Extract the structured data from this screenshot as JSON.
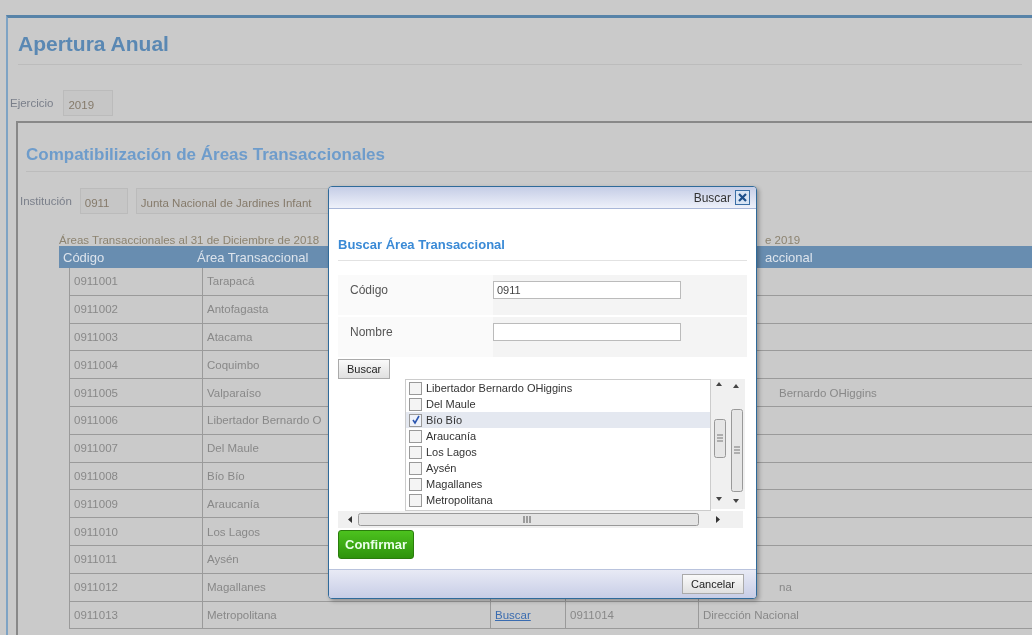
{
  "page": {
    "title": "Apertura Anual",
    "ejercicio": {
      "label": "Ejercicio",
      "value": "2019"
    }
  },
  "section": {
    "title": "Compatibilización de Áreas Transaccionales",
    "institucion": {
      "label": "Institución",
      "code": "0911",
      "name": "Junta Nacional de Jardines Infant"
    }
  },
  "table": {
    "caption_left": "Áreas Transaccionales al 31 de Diciembre de 2018",
    "caption_right": "e 2019",
    "columns": [
      "Código",
      "Área Transaccional",
      "accional"
    ],
    "rows": [
      {
        "code": "0911001",
        "area": "Tarapacá"
      },
      {
        "code": "0911002",
        "area": "Antofagasta"
      },
      {
        "code": "0911003",
        "area": "Atacama"
      },
      {
        "code": "0911004",
        "area": "Coquimbo"
      },
      {
        "code": "0911005",
        "area": "Valparaíso",
        "area2": "Bernardo OHiggins"
      },
      {
        "code": "0911006",
        "area": "Libertador Bernardo O"
      },
      {
        "code": "0911007",
        "area": "Del Maule"
      },
      {
        "code": "0911008",
        "area": "Bío Bío"
      },
      {
        "code": "0911009",
        "area": "Araucanía"
      },
      {
        "code": "0911010",
        "area": "Los Lagos"
      },
      {
        "code": "0911011",
        "area": "Aysén"
      },
      {
        "code": "0911012",
        "area": "Magallanes",
        "area2": "na"
      },
      {
        "code": "0911013",
        "area": "Metropolitana",
        "link": "Buscar",
        "code2": "0911014",
        "area2": "Dirección Nacional"
      }
    ]
  },
  "dialog": {
    "title": "Buscar",
    "heading": "Buscar Área Transaccional",
    "fields": [
      {
        "label": "Código",
        "value": "0911"
      },
      {
        "label": "Nombre"
      }
    ],
    "search_button": "Buscar",
    "items": [
      {
        "label": "Libertador Bernardo OHiggins",
        "checked": false,
        "selected": false
      },
      {
        "label": "Del Maule",
        "checked": false,
        "selected": false
      },
      {
        "label": "Bío Bío",
        "checked": true,
        "selected": true
      },
      {
        "label": "Araucanía",
        "checked": false,
        "selected": false
      },
      {
        "label": "Los Lagos",
        "checked": false,
        "selected": false
      },
      {
        "label": "Aysén",
        "checked": false,
        "selected": false
      },
      {
        "label": "Magallanes",
        "checked": false,
        "selected": false
      },
      {
        "label": "Metropolitana",
        "checked": false,
        "selected": false
      }
    ],
    "confirm_button": "Confirmar",
    "cancel_button": "Cancelar"
  }
}
